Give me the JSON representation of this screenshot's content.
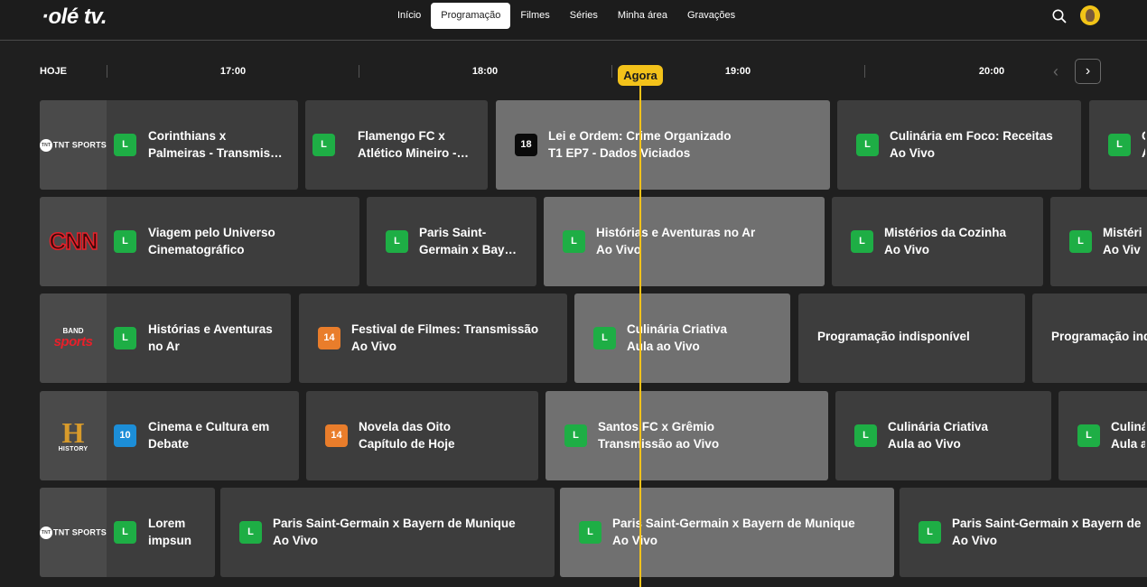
{
  "header": {
    "logo": "·olé tv.",
    "nav": [
      "Início",
      "Programação",
      "Filmes",
      "Séries",
      "Minha área",
      "Gravações"
    ],
    "active_tab": "Programação"
  },
  "timeline": {
    "day": "HOJE",
    "times": [
      "17:00",
      "18:00",
      "19:00",
      "20:00"
    ],
    "now_label": "Agora",
    "now_color": "#f3c21a"
  },
  "channels": [
    {
      "name": "TNT SPORTS",
      "logo_icon": "tnt-sports-logo",
      "programs": [
        {
          "title": "Corinthians x\nPalmeiras - Transmis…",
          "rating": "L"
        },
        {
          "title": "Flamengo FC x\nAtlético Mineiro -…",
          "rating": "L"
        },
        {
          "title": "Lei e Ordem: Crime Organizado\nT1 EP7 - Dados Viciados",
          "rating": "18",
          "live": true
        },
        {
          "title": "Culinária em Foco: Receitas\nAo Vivo",
          "rating": "L"
        },
        {
          "title": "C\nA",
          "rating": "L"
        }
      ]
    },
    {
      "name": "CNN",
      "logo_icon": "cnn-logo",
      "programs": [
        {
          "title": "Viagem pelo Universo\nCinematográfico",
          "rating": "L"
        },
        {
          "title": "Paris Saint-\nGermain x Bay…",
          "rating": "L"
        },
        {
          "title": "Histórias e Aventuras no Ar\nAo Vivo",
          "rating": "L",
          "live": true
        },
        {
          "title": "Mistérios da Cozinha\nAo Vivo",
          "rating": "L"
        },
        {
          "title": "Mistéri\nAo Viv",
          "rating": "L"
        }
      ]
    },
    {
      "name": "BAND sports",
      "logo_icon": "band-sports-logo",
      "programs": [
        {
          "title": "Histórias e Aventuras\nno Ar",
          "rating": "L"
        },
        {
          "title": "Festival de Filmes: Transmissão\nAo Vivo",
          "rating": "14"
        },
        {
          "title": "Culinária Criativa\nAula ao Vivo",
          "rating": "L",
          "live": true
        },
        {
          "title": "Programação indisponível",
          "rating": ""
        },
        {
          "title": "Programação ind",
          "rating": ""
        }
      ]
    },
    {
      "name": "HISTORY",
      "logo_icon": "history-logo",
      "programs": [
        {
          "title": "Cinema e Cultura em\nDebate",
          "rating": "10"
        },
        {
          "title": "Novela das Oito\nCapítulo de Hoje",
          "rating": "14"
        },
        {
          "title": "Santos FC x Grêmio\nTransmissão ao Vivo",
          "rating": "L",
          "live": true
        },
        {
          "title": "Culinária Criativa\nAula ao Vivo",
          "rating": "L"
        },
        {
          "title": "Culiná\nAula a",
          "rating": "L"
        }
      ]
    },
    {
      "name": "TNT SPORTS",
      "logo_icon": "tnt-sports-logo",
      "programs": [
        {
          "title": "Lorem\nimpsun",
          "rating": "L"
        },
        {
          "title": "Paris Saint-Germain x Bayern de Munique\nAo Vivo",
          "rating": "L"
        },
        {
          "title": "Paris Saint-Germain x Bayern de Munique\nAo Vivo",
          "rating": "L",
          "live": true
        },
        {
          "title": "Paris Saint-Germain x Bayern de Munique\nAo Vivo",
          "rating": "L"
        }
      ]
    }
  ]
}
